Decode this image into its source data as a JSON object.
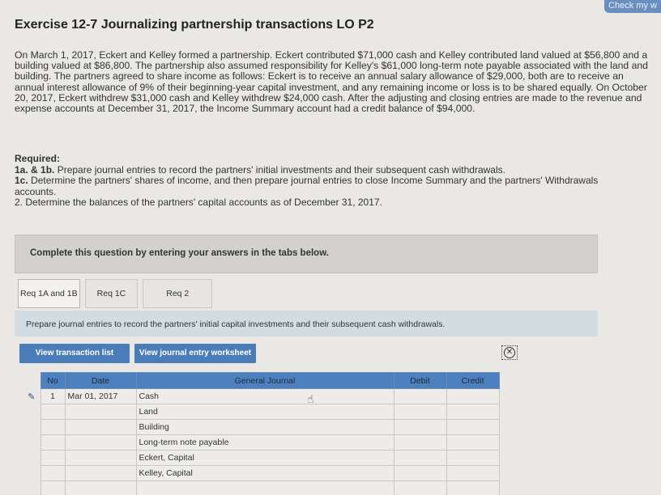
{
  "header": {
    "check_label": "Check my w"
  },
  "exercise": {
    "title": "Exercise 12-7 Journalizing partnership transactions LO P2",
    "intro": "On March 1, 2017, Eckert and Kelley formed a partnership. Eckert contributed $71,000 cash and Kelley contributed land valued at $56,800 and a building valued at $86,800. The partnership also assumed responsibility for Kelley's $61,000 long-term note payable associated with the land and building. The partners agreed to share income as follows: Eckert is to receive an annual salary allowance of $29,000, both are to receive an annual interest allowance of 9% of their beginning-year capital investment, and any remaining income or loss is to be shared equally. On October 20, 2017, Eckert withdrew $31,000 cash and Kelley withdrew $24,000 cash. After the adjusting and closing entries are made to the revenue and expense accounts at December 31, 2017, the Income Summary account had a credit balance of $94,000."
  },
  "required": {
    "heading": "Required:",
    "items": [
      {
        "num": "1a. & 1b.",
        "text": "Prepare journal entries to record the partners' initial investments and their subsequent cash withdrawals."
      },
      {
        "num": "1c.",
        "text": "Determine the partners' shares of income, and then prepare journal entries to close Income Summary and the partners' Withdrawals accounts."
      },
      {
        "num": "2.",
        "text": "Determine the balances of the partners' capital accounts as of December 31, 2017."
      }
    ]
  },
  "complete_box": "Complete this question by entering your answers in the tabs below.",
  "tabs": [
    {
      "label": "Req 1A and 1B",
      "active": true
    },
    {
      "label": "Req 1C",
      "active": false
    },
    {
      "label": "Req 2",
      "active": false
    }
  ],
  "instruction": "Prepare journal entries to record the partners' initial capital investments and their subsequent cash withdrawals.",
  "buttons": {
    "view_transactions": "View transaction list",
    "view_worksheet": "View journal entry worksheet"
  },
  "journal": {
    "headers": {
      "no": "No",
      "date": "Date",
      "account": "General Journal",
      "debit": "Debit",
      "credit": "Credit"
    },
    "entry_no": "1",
    "entry_date": "Mar 01, 2017",
    "accounts": [
      "Cash",
      "Land",
      "Building",
      "Long-term note payable",
      "Eckert, Capital",
      "Kelley, Capital"
    ]
  }
}
